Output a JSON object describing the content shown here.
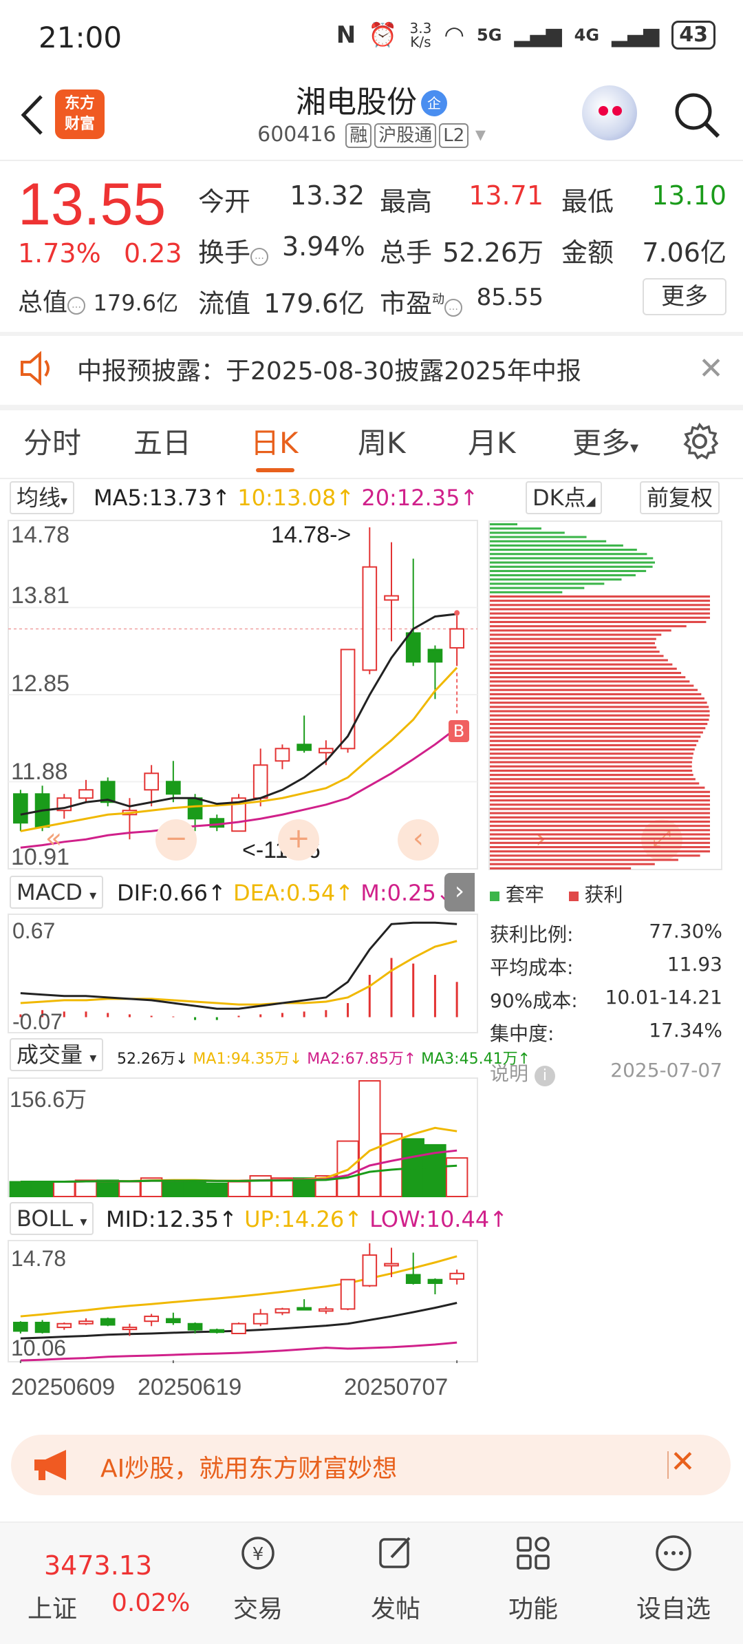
{
  "status_bar": {
    "time": "21:00",
    "speed": "3.3\nK/s",
    "net1": "5G",
    "net2": "4G",
    "battery": "43"
  },
  "header": {
    "logo": "东方\n财富",
    "name": "湘电股份",
    "badge": "企",
    "code": "600416",
    "tag1": "融",
    "tag2": "沪股通",
    "tag3": "L2"
  },
  "quote": {
    "price": "13.55",
    "pct": "1.73%",
    "change": "0.23",
    "open_label": "今开",
    "open": "13.32",
    "high_label": "最高",
    "high": "13.71",
    "low_label": "最低",
    "low": "13.10",
    "turnover_label": "换手",
    "turnover": "3.94%",
    "volume_label": "总手",
    "volume": "52.26万",
    "amount_label": "金额",
    "amount": "7.06亿",
    "mcap_label": "总值",
    "mcap": "179.6亿",
    "float_label": "流值",
    "float": "179.6亿",
    "pe_label": "市盈",
    "pe_sup": "动",
    "pe": "85.55",
    "more": "更多"
  },
  "notice": {
    "text": "中报预披露：于2025-08-30披露2025年中报"
  },
  "tabs": [
    "分时",
    "五日",
    "日K",
    "周K",
    "月K",
    "更多"
  ],
  "ma_bar": {
    "selector": "均线",
    "ma5": "MA5:13.73↑",
    "ma10": "10:13.08↑",
    "ma20": "20:12.35↑",
    "dk": "DK点",
    "fq": "前复权"
  },
  "kline": {
    "y_labels": [
      "14.78",
      "13.81",
      "12.85",
      "11.88",
      "10.91"
    ],
    "high_marker": "14.78->",
    "low_marker": "<-11.16",
    "b_marker": "B"
  },
  "chip_legend": {
    "trapped": "套牢",
    "profit": "获利"
  },
  "chip_info": {
    "rows": [
      {
        "label": "获利比例:",
        "value": "77.30%"
      },
      {
        "label": "平均成本:",
        "value": "11.93"
      },
      {
        "label": "90%成本:",
        "value": "10.01-14.21"
      },
      {
        "label": "集中度:",
        "value": "17.34%"
      }
    ],
    "note": "说明",
    "date": "2025-07-07"
  },
  "macd": {
    "selector": "MACD",
    "dif": "DIF:0.66↑",
    "dea": "DEA:0.54↑",
    "m": "M:0.25↓",
    "y_top": "0.67",
    "y_bot": "-0.07"
  },
  "volume": {
    "selector": "成交量",
    "v": "52.26万↓",
    "ma1": "MA1:94.35万↓",
    "ma2": "MA2:67.85万↑",
    "ma3": "MA3:45.41万↑",
    "y_top": "156.6万"
  },
  "boll": {
    "selector": "BOLL",
    "mid": "MID:12.35↑",
    "up": "UP:14.26↑",
    "low": "LOW:10.44↑",
    "y_top": "14.78",
    "y_bot": "10.06"
  },
  "dates": [
    "20250609",
    "20250619",
    "20250707"
  ],
  "chart_data": {
    "type": "candlestick",
    "candles": [
      {
        "o": 11.55,
        "c": 11.2,
        "h": 11.6,
        "l": 11.1
      },
      {
        "o": 11.55,
        "c": 11.15,
        "h": 11.65,
        "l": 11.1
      },
      {
        "o": 11.35,
        "c": 11.5,
        "h": 11.55,
        "l": 11.25
      },
      {
        "o": 11.5,
        "c": 11.6,
        "h": 11.72,
        "l": 11.45
      },
      {
        "o": 11.7,
        "c": 11.45,
        "h": 11.75,
        "l": 11.4
      },
      {
        "o": 11.3,
        "c": 11.35,
        "h": 11.5,
        "l": 11.0
      },
      {
        "o": 11.6,
        "c": 11.8,
        "h": 11.9,
        "l": 11.4
      },
      {
        "o": 11.7,
        "c": 11.55,
        "h": 11.95,
        "l": 11.45
      },
      {
        "o": 11.5,
        "c": 11.25,
        "h": 11.55,
        "l": 11.1
      },
      {
        "o": 11.25,
        "c": 11.15,
        "h": 11.3,
        "l": 11.1
      },
      {
        "o": 11.1,
        "c": 11.5,
        "h": 11.55,
        "l": 11.1
      },
      {
        "o": 11.5,
        "c": 11.9,
        "h": 12.1,
        "l": 11.4
      },
      {
        "o": 11.95,
        "c": 12.1,
        "h": 12.15,
        "l": 11.85
      },
      {
        "o": 12.15,
        "c": 12.08,
        "h": 12.5,
        "l": 12.05
      },
      {
        "o": 12.05,
        "c": 12.1,
        "h": 12.2,
        "l": 11.9
      },
      {
        "o": 12.1,
        "c": 13.3,
        "h": 13.3,
        "l": 12.05
      },
      {
        "o": 13.05,
        "c": 14.3,
        "h": 14.78,
        "l": 13.0
      },
      {
        "o": 13.9,
        "c": 13.95,
        "h": 14.6,
        "l": 13.4
      },
      {
        "o": 13.5,
        "c": 13.15,
        "h": 14.4,
        "l": 13.1
      },
      {
        "o": 13.3,
        "c": 13.15,
        "h": 13.35,
        "l": 12.7
      },
      {
        "o": 13.32,
        "c": 13.55,
        "h": 13.71,
        "l": 13.1
      }
    ],
    "ma5": [
      11.3,
      11.35,
      11.38,
      11.45,
      11.48,
      11.4,
      11.45,
      11.5,
      11.5,
      11.43,
      11.45,
      11.5,
      11.6,
      11.75,
      11.95,
      12.25,
      12.75,
      13.2,
      13.55,
      13.7,
      13.73
    ],
    "ma10": [
      11.1,
      11.15,
      11.2,
      11.25,
      11.3,
      11.32,
      11.35,
      11.38,
      11.4,
      11.41,
      11.43,
      11.46,
      11.5,
      11.56,
      11.62,
      11.75,
      11.98,
      12.2,
      12.45,
      12.8,
      13.08
    ],
    "ma20": [
      10.9,
      10.93,
      10.97,
      11.0,
      11.05,
      11.08,
      11.1,
      11.13,
      11.16,
      11.18,
      11.21,
      11.25,
      11.3,
      11.36,
      11.42,
      11.5,
      11.65,
      11.8,
      11.97,
      12.15,
      12.35
    ],
    "ylim": [
      10.91,
      14.78
    ],
    "volume": [
      20,
      20,
      20,
      22,
      22,
      20,
      25,
      22,
      22,
      18,
      20,
      28,
      25,
      25,
      28,
      75,
      156.6,
      85,
      78,
      70,
      52.26
    ],
    "macd_hist": [
      0.02,
      0.05,
      0.04,
      0.04,
      0.03,
      0.02,
      0.01,
      0.005,
      -0.02,
      -0.02,
      0.01,
      0.02,
      0.03,
      0.04,
      0.05,
      0.1,
      0.3,
      0.42,
      0.38,
      0.3,
      0.25
    ],
    "dif": [
      0.17,
      0.16,
      0.15,
      0.15,
      0.14,
      0.13,
      0.12,
      0.1,
      0.08,
      0.06,
      0.06,
      0.08,
      0.1,
      0.12,
      0.14,
      0.25,
      0.48,
      0.66,
      0.67,
      0.67,
      0.66
    ],
    "dea": [
      0.1,
      0.11,
      0.12,
      0.12,
      0.13,
      0.13,
      0.13,
      0.12,
      0.11,
      0.1,
      0.09,
      0.09,
      0.1,
      0.1,
      0.11,
      0.14,
      0.22,
      0.33,
      0.42,
      0.5,
      0.54
    ]
  },
  "bottom_bar": {
    "index_value": "3473.13",
    "index_name": "上证",
    "index_pct": "0.02%",
    "items": [
      "交易",
      "发帖",
      "功能",
      "设自选"
    ]
  },
  "ad": {
    "text": "AI炒股，就用东方财富妙想"
  },
  "colors": {
    "up": "#e33333",
    "down": "#1a9b1a",
    "accent": "#e8601c"
  }
}
